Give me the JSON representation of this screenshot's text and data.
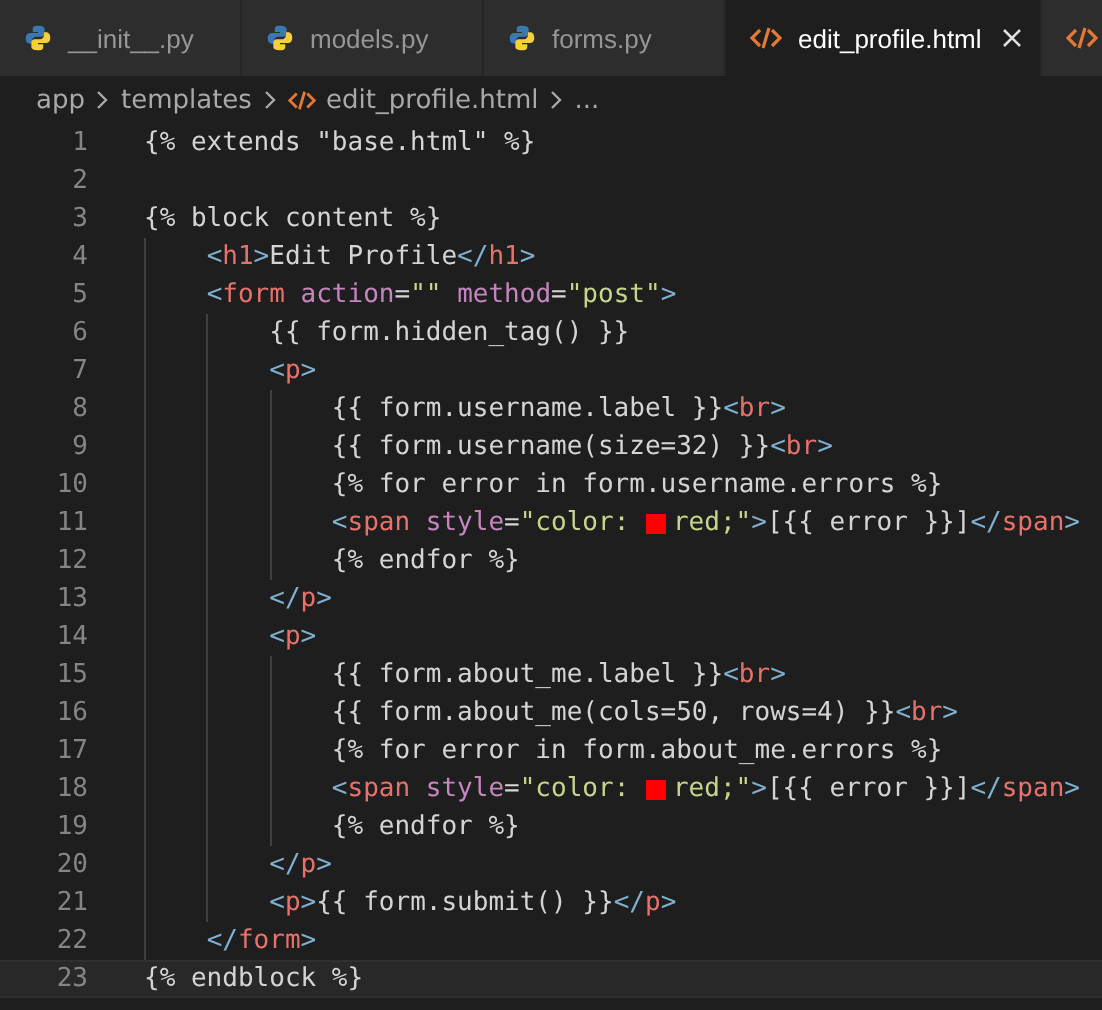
{
  "tabs": [
    {
      "label": "__init__.py",
      "kind": "python",
      "selected": false
    },
    {
      "label": "models.py",
      "kind": "python",
      "selected": false
    },
    {
      "label": "forms.py",
      "kind": "python",
      "selected": false
    },
    {
      "label": "edit_profile.html",
      "kind": "html",
      "selected": true
    },
    {
      "kind": "html",
      "selected": false
    }
  ],
  "breadcrumb": [
    {
      "label": "app"
    },
    {
      "label": "templates"
    },
    {
      "label": "edit_profile.html",
      "kind": "html"
    },
    {
      "label": "..."
    }
  ],
  "editor": {
    "lines": [
      {
        "number": "1",
        "tokens": [
          {
            "kind": "text",
            "text": "{% extends \"base.html\" %}"
          }
        ]
      },
      {
        "number": "2"
      },
      {
        "number": "3",
        "tokens": [
          {
            "kind": "text",
            "text": "{% block content %}"
          }
        ]
      },
      {
        "number": "4",
        "tokens": [
          {
            "kind": "bracket",
            "text": "    <"
          },
          {
            "kind": "tag",
            "text": "h1"
          },
          {
            "kind": "bracket",
            "text": ">"
          },
          {
            "kind": "text",
            "text": "Edit Profile"
          },
          {
            "kind": "bracket",
            "text": "</"
          },
          {
            "kind": "tag",
            "text": "h1"
          },
          {
            "kind": "bracket",
            "text": ">"
          }
        ]
      },
      {
        "number": "5",
        "tokens": [
          {
            "kind": "bracket",
            "text": "    <"
          },
          {
            "kind": "tag",
            "text": "form"
          },
          {
            "kind": "attr",
            "text": " action"
          },
          {
            "kind": "text",
            "text": "="
          },
          {
            "kind": "string",
            "text": "\"\""
          },
          {
            "kind": "attr",
            "text": " method"
          },
          {
            "kind": "text",
            "text": "="
          },
          {
            "kind": "string",
            "text": "\"post\""
          },
          {
            "kind": "bracket",
            "text": ">"
          }
        ]
      },
      {
        "number": "6",
        "tokens": [
          {
            "kind": "text",
            "text": "        {{ form.hidden_tag() }}"
          }
        ]
      },
      {
        "number": "7",
        "tokens": [
          {
            "kind": "bracket",
            "text": "        <"
          },
          {
            "kind": "tag",
            "text": "p"
          },
          {
            "kind": "bracket",
            "text": ">"
          }
        ]
      },
      {
        "number": "8",
        "tokens": [
          {
            "kind": "text",
            "text": "            {{ form.username.label }}"
          },
          {
            "kind": "bracket",
            "text": "<"
          },
          {
            "kind": "tag",
            "text": "br"
          },
          {
            "kind": "bracket",
            "text": ">"
          }
        ]
      },
      {
        "number": "9",
        "tokens": [
          {
            "kind": "text",
            "text": "            {{ form.username(size=32) }}"
          },
          {
            "kind": "bracket",
            "text": "<"
          },
          {
            "kind": "tag",
            "text": "br"
          },
          {
            "kind": "bracket",
            "text": ">"
          }
        ]
      },
      {
        "number": "10",
        "tokens": [
          {
            "kind": "text",
            "text": "            {% for error in form.username.errors %}"
          }
        ]
      },
      {
        "number": "11",
        "tokens": [
          {
            "kind": "bracket",
            "text": "            <"
          },
          {
            "kind": "tag",
            "text": "span"
          },
          {
            "kind": "attr",
            "text": " style"
          },
          {
            "kind": "text",
            "text": "="
          },
          {
            "kind": "string",
            "text": "\"color: "
          },
          {
            "kind": "swatch",
            "color": "#ff0000"
          },
          {
            "kind": "string",
            "text": "red;\""
          },
          {
            "kind": "bracket",
            "text": ">"
          },
          {
            "kind": "text",
            "text": "[{{ error }}]"
          },
          {
            "kind": "bracket",
            "text": "</"
          },
          {
            "kind": "tag",
            "text": "span"
          },
          {
            "kind": "bracket",
            "text": ">"
          }
        ]
      },
      {
        "number": "12",
        "tokens": [
          {
            "kind": "text",
            "text": "            {% endfor %}"
          }
        ]
      },
      {
        "number": "13",
        "tokens": [
          {
            "kind": "bracket",
            "text": "        </"
          },
          {
            "kind": "tag",
            "text": "p"
          },
          {
            "kind": "bracket",
            "text": ">"
          }
        ]
      },
      {
        "number": "14",
        "tokens": [
          {
            "kind": "bracket",
            "text": "        <"
          },
          {
            "kind": "tag",
            "text": "p"
          },
          {
            "kind": "bracket",
            "text": ">"
          }
        ]
      },
      {
        "number": "15",
        "tokens": [
          {
            "kind": "text",
            "text": "            {{ form.about_me.label }}"
          },
          {
            "kind": "bracket",
            "text": "<"
          },
          {
            "kind": "tag",
            "text": "br"
          },
          {
            "kind": "bracket",
            "text": ">"
          }
        ]
      },
      {
        "number": "16",
        "tokens": [
          {
            "kind": "text",
            "text": "            {{ form.about_me(cols=50, rows=4) }}"
          },
          {
            "kind": "bracket",
            "text": "<"
          },
          {
            "kind": "tag",
            "text": "br"
          },
          {
            "kind": "bracket",
            "text": ">"
          }
        ]
      },
      {
        "number": "17",
        "tokens": [
          {
            "kind": "text",
            "text": "            {% for error in form.about_me.errors %}"
          }
        ]
      },
      {
        "number": "18",
        "tokens": [
          {
            "kind": "bracket",
            "text": "            <"
          },
          {
            "kind": "tag",
            "text": "span"
          },
          {
            "kind": "attr",
            "text": " style"
          },
          {
            "kind": "text",
            "text": "="
          },
          {
            "kind": "string",
            "text": "\"color: "
          },
          {
            "kind": "swatch",
            "color": "#ff0000"
          },
          {
            "kind": "string",
            "text": "red;\""
          },
          {
            "kind": "bracket",
            "text": ">"
          },
          {
            "kind": "text",
            "text": "[{{ error }}]"
          },
          {
            "kind": "bracket",
            "text": "</"
          },
          {
            "kind": "tag",
            "text": "span"
          },
          {
            "kind": "bracket",
            "text": ">"
          }
        ]
      },
      {
        "number": "19",
        "tokens": [
          {
            "kind": "text",
            "text": "            {% endfor %}"
          }
        ]
      },
      {
        "number": "20",
        "tokens": [
          {
            "kind": "bracket",
            "text": "        </"
          },
          {
            "kind": "tag",
            "text": "p"
          },
          {
            "kind": "bracket",
            "text": ">"
          }
        ]
      },
      {
        "number": "21",
        "tokens": [
          {
            "kind": "bracket",
            "text": "        <"
          },
          {
            "kind": "tag",
            "text": "p"
          },
          {
            "kind": "bracket",
            "text": ">"
          },
          {
            "kind": "text",
            "text": "{{ form.submit() }}"
          },
          {
            "kind": "bracket",
            "text": "</"
          },
          {
            "kind": "tag",
            "text": "p"
          },
          {
            "kind": "bracket",
            "text": ">"
          }
        ]
      },
      {
        "number": "22",
        "tokens": [
          {
            "kind": "bracket",
            "text": "    </"
          },
          {
            "kind": "tag",
            "text": "form"
          },
          {
            "kind": "bracket",
            "text": ">"
          }
        ]
      },
      {
        "number": "23",
        "current": true,
        "tokens": [
          {
            "kind": "text",
            "text": "{% endblock %}"
          }
        ]
      }
    ]
  }
}
